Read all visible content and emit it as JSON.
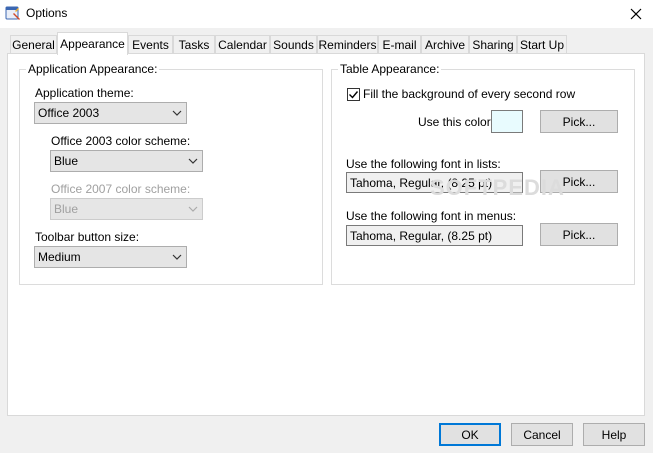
{
  "window": {
    "title": "Options"
  },
  "tabs": [
    {
      "label": "General"
    },
    {
      "label": "Appearance"
    },
    {
      "label": "Events"
    },
    {
      "label": "Tasks"
    },
    {
      "label": "Calendar"
    },
    {
      "label": "Sounds"
    },
    {
      "label": "Reminders"
    },
    {
      "label": "E-mail"
    },
    {
      "label": "Archive"
    },
    {
      "label": "Sharing"
    },
    {
      "label": "Start Up"
    }
  ],
  "app_appearance": {
    "title": "Application Appearance:",
    "theme_label": "Application theme:",
    "theme_value": "Office 2003",
    "scheme2003_label": "Office 2003 color scheme:",
    "scheme2003_value": "Blue",
    "scheme2007_label": "Office 2007 color scheme:",
    "scheme2007_value": "Blue",
    "toolbar_label": "Toolbar button size:",
    "toolbar_value": "Medium"
  },
  "table_appearance": {
    "title": "Table Appearance:",
    "fill_label": "Fill the background of every second row",
    "fill_checked": true,
    "color_label": "Use this color",
    "color_value": "#e8fbfe",
    "pick_label": "Pick...",
    "lists_font_label": "Use the following font in lists:",
    "lists_font_value": "Tahoma, Regular, (8.25 pt)",
    "menus_font_label": "Use the following font in menus:",
    "menus_font_value": "Tahoma, Regular, (8.25 pt)"
  },
  "watermark": "SOFTPEDIA",
  "buttons": {
    "ok": "OK",
    "cancel": "Cancel",
    "help": "Help"
  },
  "colors": {
    "accent": "#0078d7"
  }
}
